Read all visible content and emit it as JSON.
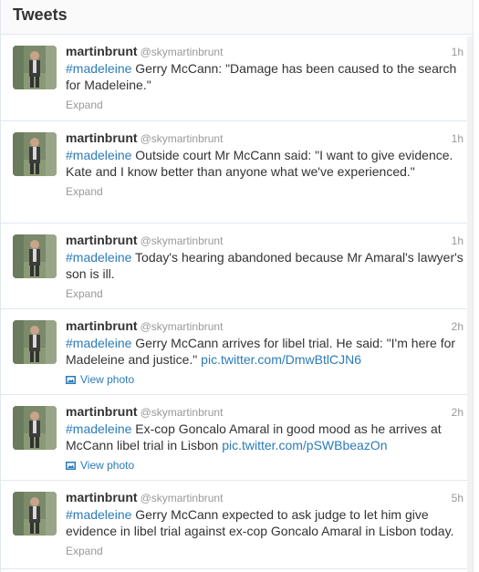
{
  "header": {
    "title": "Tweets"
  },
  "tweets": [
    {
      "name": "martinbrunt",
      "handle": "@skymartinbrunt",
      "time": "1h",
      "hashtag": "#madeleine",
      "text": " Gerry McCann: \"Damage has been caused to the search for Madeleine.\"",
      "link": "",
      "action": "Expand",
      "action_type": "expand"
    },
    {
      "name": "martinbrunt",
      "handle": "@skymartinbrunt",
      "time": "1h",
      "hashtag": "#madeleine",
      "text": " Outside court Mr McCann said: \"I want to give evidence. Kate and I know better than anyone what we've experienced.\"",
      "link": "",
      "action": "Expand",
      "action_type": "expand"
    },
    {
      "name": "martinbrunt",
      "handle": "@skymartinbrunt",
      "time": "1h",
      "hashtag": "#madeleine",
      "text": " Today's hearing abandoned because Mr Amaral's lawyer's son is ill.",
      "link": "",
      "action": "Expand",
      "action_type": "expand"
    },
    {
      "name": "martinbrunt",
      "handle": "@skymartinbrunt",
      "time": "2h",
      "hashtag": "#madeleine",
      "text": " Gerry McCann arrives for libel trial. He said: \"I'm here for Madeleine and justice.\" ",
      "link": "pic.twitter.com/DmwBtlCJN6",
      "action": "View photo",
      "action_type": "photo"
    },
    {
      "name": "martinbrunt",
      "handle": "@skymartinbrunt",
      "time": "2h",
      "hashtag": "#madeleine",
      "text": " Ex-cop Goncalo Amaral in good mood as he arrives at McCann libel trial in Lisbon ",
      "link": "pic.twitter.com/pSWBbeazOn",
      "action": "View photo",
      "action_type": "photo"
    },
    {
      "name": "martinbrunt",
      "handle": "@skymartinbrunt",
      "time": "5h",
      "hashtag": "#madeleine",
      "text": " Gerry McCann expected to ask judge to let him give evidence in libel trial against ex-cop Goncalo Amaral in Lisbon today.",
      "link": "",
      "action": "Expand",
      "action_type": "expand"
    }
  ]
}
